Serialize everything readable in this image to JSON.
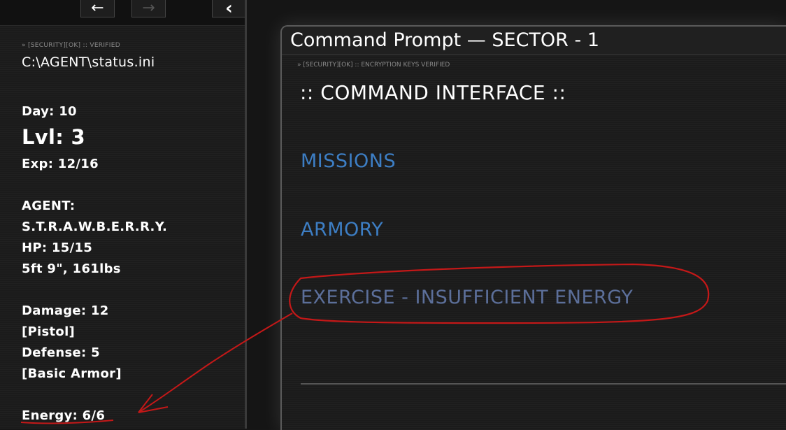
{
  "nav": {
    "back_icon": "←",
    "forward_icon": "→",
    "collapse_icon": "‹"
  },
  "sidebar": {
    "security_line": "» [SECURITY][OK] :: VERIFIED",
    "file_path": "C:\\AGENT\\status.ini",
    "day": "Day: 10",
    "level": "Lvl: 3",
    "exp": "Exp: 12/16",
    "agent_label": "AGENT:",
    "agent_name": "S.T.R.A.W.B.E.R.R.Y.",
    "hp": "HP: 15/15",
    "physique": "5ft 9\", 161lbs",
    "damage": "Damage: 12",
    "weapon": "[Pistol]",
    "defense": "Defense: 5",
    "armor": "[Basic Armor]",
    "energy": "Energy: 6/6"
  },
  "window": {
    "title": "Command Prompt — SECTOR - 1",
    "security_line": "» [SECURITY][OK] :: ENCRYPTION KEYS VERIFIED",
    "header": ":: COMMAND INTERFACE ::",
    "menu": {
      "missions": "MISSIONS",
      "armory": "ARMORY",
      "exercise": "EXERCISE - INSUFFICIENT ENERGY"
    }
  },
  "colors": {
    "link_blue": "#3d7ec4",
    "disabled_blue": "#5c6f9a",
    "annotation_red": "#c41818"
  }
}
